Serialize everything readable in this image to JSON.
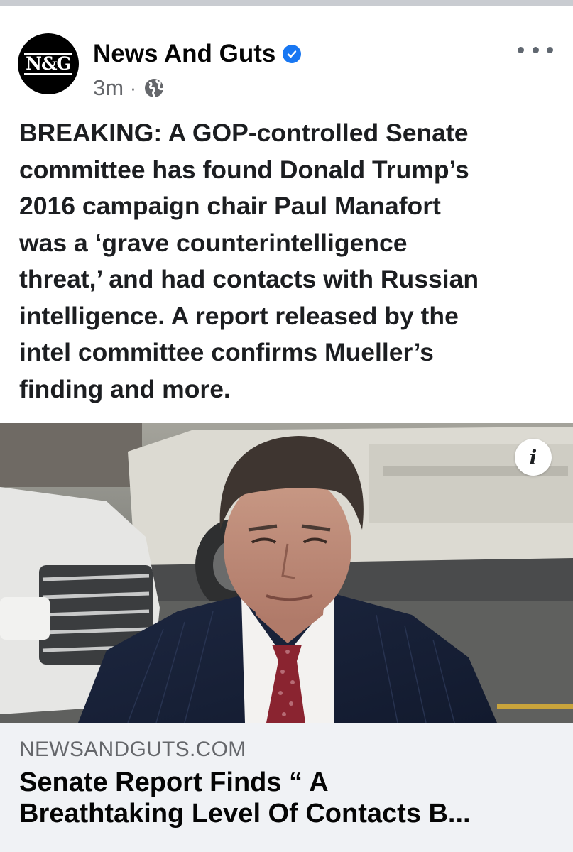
{
  "post": {
    "page_name": "News And Guts",
    "avatar_text": "N&G",
    "timestamp": "3m",
    "separator": "·",
    "audience_icon": "globe-icon",
    "verified_icon": "verified-badge-icon",
    "more_icon": "more-options-icon",
    "text": "BREAKING:  A GOP-controlled Senate\ncommittee has found Donald Trump’s\n2016 campaign chair Paul Manafort\nwas a ‘grave counterintelligence\nthreat,’ and had contacts with Russian\nintelligence. A report released by the\nintel committee confirms Mueller’s\nfinding and more."
  },
  "link_preview": {
    "info_icon": "info-icon",
    "info_label": "i",
    "domain": "NEWSANDGUTS.COM",
    "title": "Senate Report Finds “ A\nBreathtaking Level Of Contacts B..."
  },
  "colors": {
    "accent_blue": "#1877f2",
    "secondary_text": "#65676b",
    "link_card_bg": "#f0f2f5"
  }
}
